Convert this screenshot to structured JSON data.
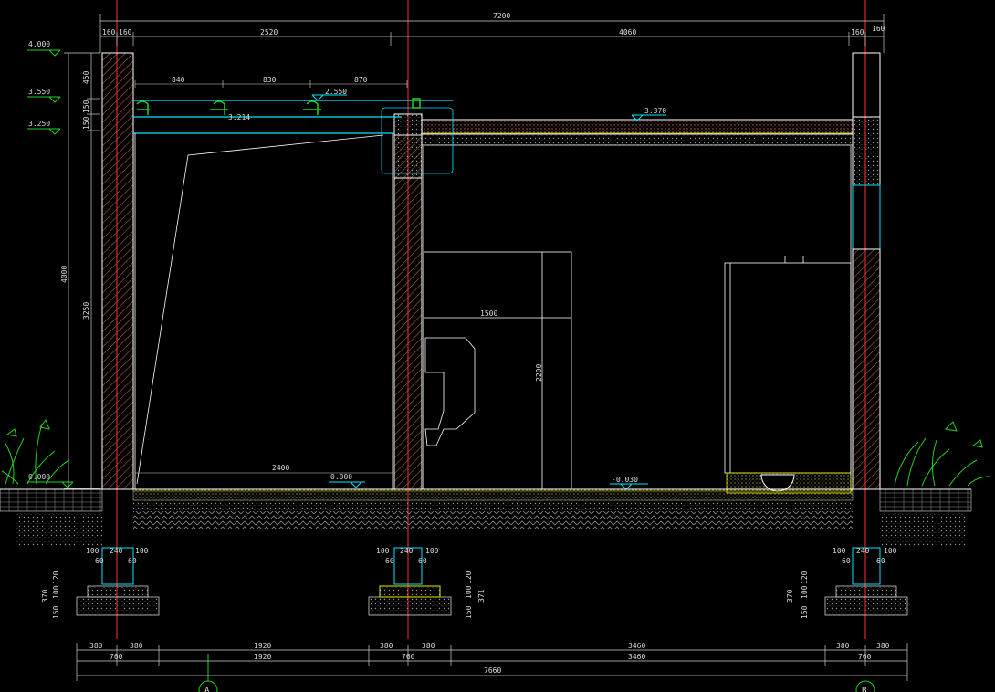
{
  "dimensions_top": {
    "total": "7200",
    "seg_left_a": "160",
    "seg_left_b": "160",
    "seg_left_room": "2520",
    "seg_right_room": "4060",
    "seg_right_a": "160",
    "seg_right_b": "160"
  },
  "canopy_spacing": [
    "840",
    "830",
    "870"
  ],
  "levels": {
    "top": "4.000",
    "mid": "3.550",
    "low": "3.250",
    "canopy": "2.550",
    "roof": "3.370",
    "ground_left": "0.000",
    "floor_left": "0.000",
    "floor_right": "-0.030"
  },
  "dimensions_left": {
    "overall": "4000",
    "inner": "3250",
    "a": "450",
    "b": "150",
    "c": "150"
  },
  "interior": {
    "width_left": "2400",
    "width_right": "1500",
    "height_right": "2200",
    "canopy_note": "3.214"
  },
  "footing": {
    "w_240": "240",
    "w_100": "100",
    "w_60": "60",
    "h_120": "120",
    "h_100": "100",
    "h_370": "370",
    "h_150": "150",
    "h_371": "371"
  },
  "dimensions_bottom": {
    "row1": [
      "380",
      "380",
      "1920",
      "380",
      "380",
      "3460",
      "380",
      "380"
    ],
    "row2": [
      "760",
      "1920",
      "760",
      "3460",
      "760"
    ],
    "total": "7660"
  },
  "axes": [
    "A",
    "B"
  ],
  "colors": {
    "background": "#000000",
    "line": "#ffffff",
    "dim": "#dcdcdc",
    "axis": "#ff3030",
    "cyan": "#00e5ff",
    "green": "#21d421",
    "yellow": "#e6e600",
    "brown": "#b05a3c"
  }
}
